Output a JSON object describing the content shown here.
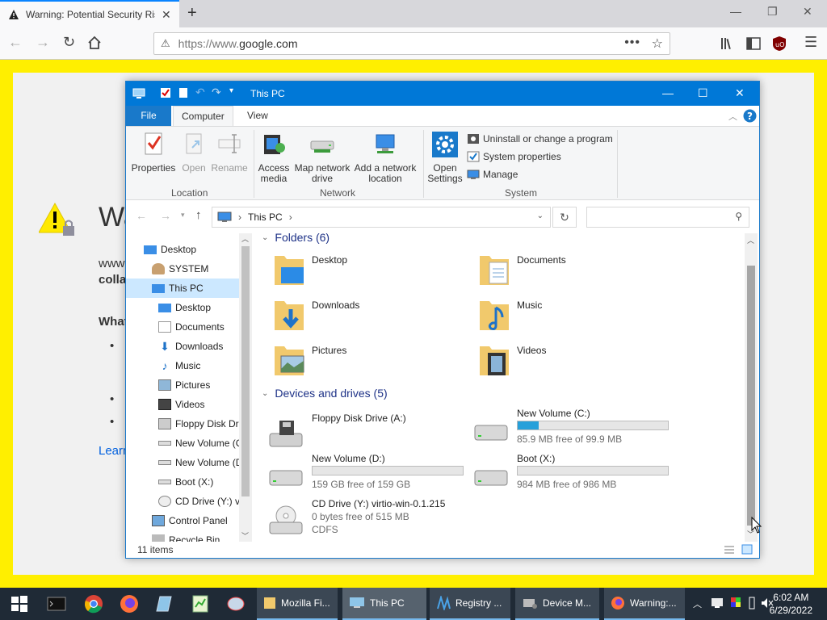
{
  "browser": {
    "tab_title": "Warning: Potential Security Risk Ahead",
    "url": "https://www.google.com",
    "url_prefix": "https://www.",
    "url_domain": "google.com"
  },
  "page": {
    "heading": "Wa",
    "text1": "www",
    "text2": "colla",
    "text3": "What",
    "text4": "Learn"
  },
  "explorer": {
    "title": "This PC",
    "tabs": {
      "file": "File",
      "computer": "Computer",
      "view": "View"
    },
    "ribbon": {
      "properties": "Properties",
      "open": "Open",
      "rename": "Rename",
      "access_media": "Access media",
      "map_drive": "Map network drive",
      "add_location": "Add a network location",
      "open_settings": "Open Settings",
      "uninstall": "Uninstall or change a program",
      "sys_props": "System properties",
      "manage": "Manage",
      "grp_location": "Location",
      "grp_network": "Network",
      "grp_system": "System"
    },
    "address": "This PC",
    "search_placeholder": "",
    "nav": [
      "Desktop",
      "SYSTEM",
      "This PC",
      "Desktop",
      "Documents",
      "Downloads",
      "Music",
      "Pictures",
      "Videos",
      "Floppy Disk Dri",
      "New Volume (C",
      "New Volume (D",
      "Boot (X:)",
      "CD Drive (Y:) vi",
      "Control Panel",
      "Recycle Bin"
    ],
    "folders_header": "Folders (6)",
    "folders": [
      "Desktop",
      "Documents",
      "Downloads",
      "Music",
      "Pictures",
      "Videos"
    ],
    "drives_header": "Devices and drives (5)",
    "drives": [
      {
        "name": "Floppy Disk Drive (A:)",
        "free": "",
        "used_pct": null
      },
      {
        "name": "New Volume (C:)",
        "free": "85.9 MB free of 99.9 MB",
        "used_pct": 14
      },
      {
        "name": "New Volume (D:)",
        "free": "159 GB free of 159 GB",
        "used_pct": 0
      },
      {
        "name": "Boot (X:)",
        "free": "984 MB free of 986 MB",
        "used_pct": 0
      },
      {
        "name": "CD Drive (Y:) virtio-win-0.1.215",
        "free": "0 bytes free of 515 MB",
        "fs": "CDFS",
        "used_pct": null
      }
    ],
    "status": "11 items"
  },
  "taskbar": {
    "items": [
      "Mozilla Fi...",
      "This PC",
      "Registry ...",
      "Device M...",
      "Warning:..."
    ],
    "time": "6:02 AM",
    "date": "6/29/2022"
  },
  "colors": {
    "accent": "#0078d7",
    "page_border": "#ffef00",
    "taskbar": "#1f2a36"
  }
}
